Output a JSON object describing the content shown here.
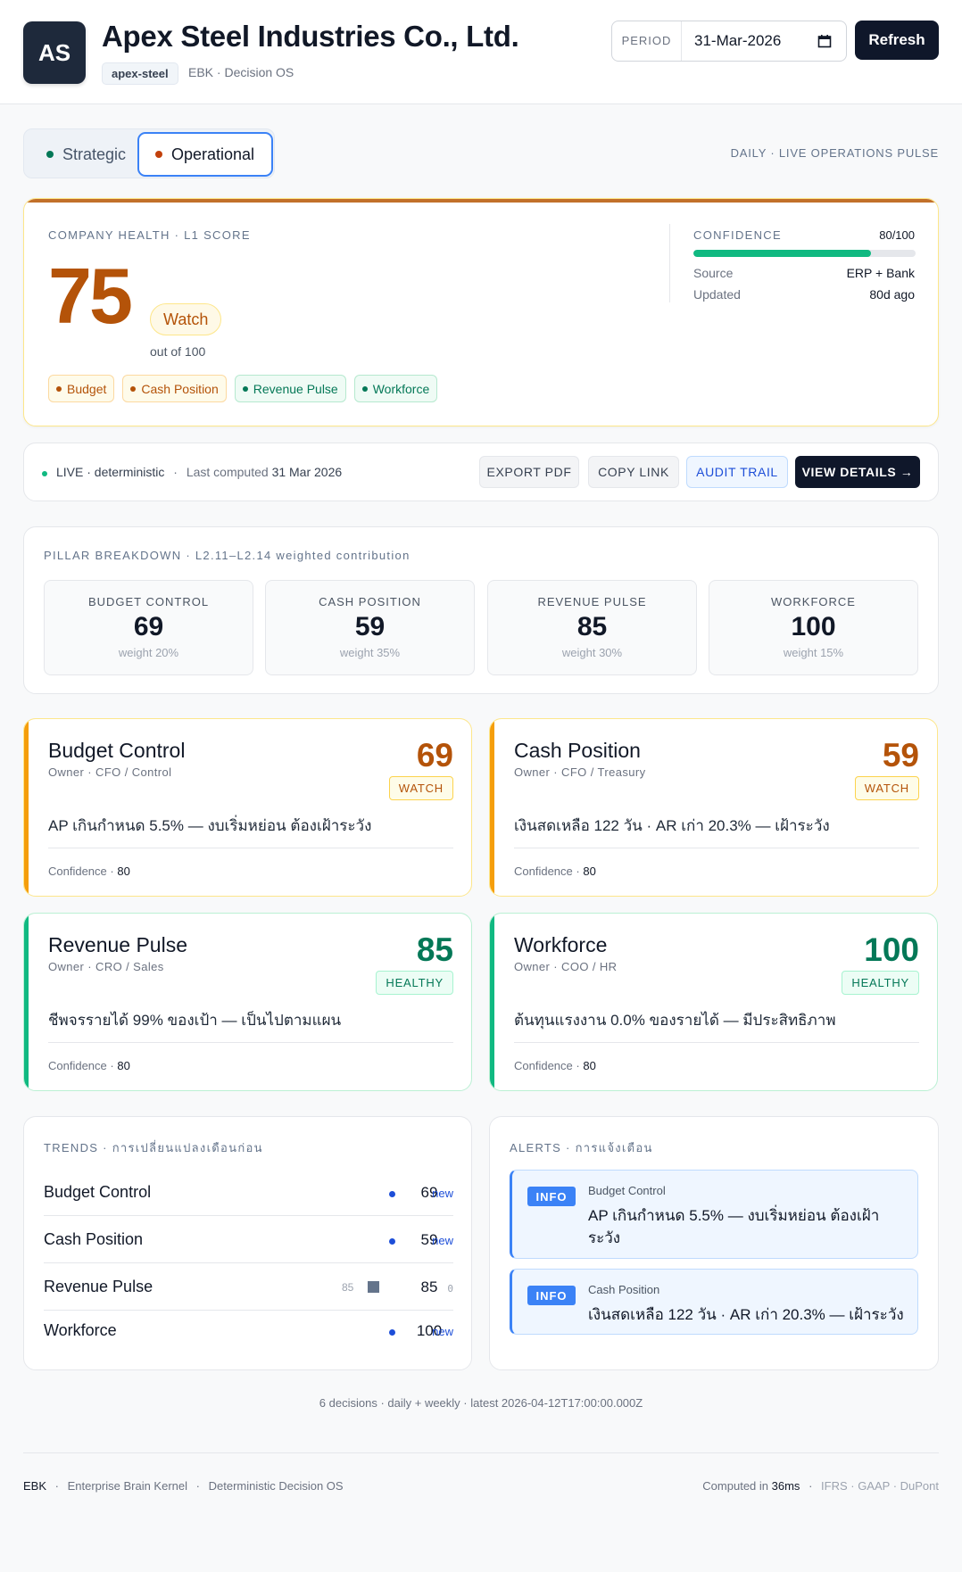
{
  "header": {
    "logo_initials": "AS",
    "company_name": "Apex Steel Industries Co., Ltd.",
    "slug": "apex-steel",
    "subtitle": "EBK · Decision OS",
    "period_label": "PERIOD",
    "period_value": "31-Mar-2026",
    "refresh_label": "Refresh"
  },
  "tabs": [
    {
      "label": "Strategic",
      "active": false,
      "dot_color": "#047857"
    },
    {
      "label": "Operational",
      "active": true,
      "dot_color": "#c2410c"
    }
  ],
  "pulse_label": "DAILY · LIVE OPERATIONS PULSE",
  "health": {
    "section_label": "COMPANY HEALTH · L1 SCORE",
    "score": "75",
    "status": "Watch",
    "out_of": "out of 100",
    "chips": [
      {
        "label": "Budget",
        "tone": "amber"
      },
      {
        "label": "Cash Position",
        "tone": "amber"
      },
      {
        "label": "Revenue Pulse",
        "tone": "green"
      },
      {
        "label": "Workforce",
        "tone": "green"
      }
    ],
    "confidence_label": "CONFIDENCE",
    "confidence_value": "80/100",
    "confidence_fraction": 0.8,
    "source_label": "Source",
    "source_value": "ERP + Bank",
    "updated_label": "Updated",
    "updated_value": "80d ago"
  },
  "action_bar": {
    "live_text": "LIVE · deterministic",
    "separator": "·",
    "last_computed_prefix": "Last computed",
    "last_computed_value": "31 Mar 2026",
    "export_pdf": "EXPORT PDF",
    "copy_link": "COPY LINK",
    "audit_trail": "AUDIT TRAIL",
    "view_details": "VIEW DETAILS →"
  },
  "breakdown": {
    "section_label": "PILLAR BREAKDOWN · L2.11–L2.14 weighted contribution",
    "pillars": [
      {
        "name": "BUDGET CONTROL",
        "score": "69",
        "weight": "weight 20%"
      },
      {
        "name": "CASH POSITION",
        "score": "59",
        "weight": "weight 35%"
      },
      {
        "name": "REVENUE PULSE",
        "score": "85",
        "weight": "weight 30%"
      },
      {
        "name": "WORKFORCE",
        "score": "100",
        "weight": "weight 15%"
      }
    ]
  },
  "pillar_cards": [
    {
      "title": "Budget Control",
      "owner": "Owner · CFO / Control",
      "score": "69",
      "status": "WATCH",
      "tone": "amber",
      "score_color": "#b45309",
      "description": "AP เกินกำหนด 5.5% — งบเริ่มหย่อน ต้องเฝ้าระวัง",
      "confidence_label": "Confidence ·",
      "confidence": "80"
    },
    {
      "title": "Cash Position",
      "owner": "Owner · CFO / Treasury",
      "score": "59",
      "status": "WATCH",
      "tone": "amber",
      "score_color": "#b45309",
      "description": "เงินสดเหลือ 122 วัน · AR เก่า 20.3% — เฝ้าระวัง",
      "confidence_label": "Confidence ·",
      "confidence": "80"
    },
    {
      "title": "Revenue Pulse",
      "owner": "Owner · CRO / Sales",
      "score": "85",
      "status": "HEALTHY",
      "tone": "green",
      "score_color": "#047857",
      "description": "ชีพจรรายได้ 99% ของเป้า — เป็นไปตามแผน",
      "confidence_label": "Confidence ·",
      "confidence": "80"
    },
    {
      "title": "Workforce",
      "owner": "Owner · COO / HR",
      "score": "100",
      "status": "HEALTHY",
      "tone": "green",
      "score_color": "#047857",
      "description": "ต้นทุนแรงงาน 0.0% ของรายได้ — มีประสิทธิภาพ",
      "confidence_label": "Confidence ·",
      "confidence": "80"
    }
  ],
  "trends": {
    "section_label": "TRENDS · การเปลี่ยนแปลงเดือนก่อน",
    "rows": [
      {
        "name": "Budget Control",
        "previous": "",
        "value": "69",
        "delta": "new",
        "marker": "dot"
      },
      {
        "name": "Cash Position",
        "previous": "",
        "value": "59",
        "delta": "new",
        "marker": "dot"
      },
      {
        "name": "Revenue Pulse",
        "previous": "85",
        "value": "85",
        "delta": "0",
        "marker": "square"
      },
      {
        "name": "Workforce",
        "previous": "",
        "value": "100",
        "delta": "new",
        "marker": "dot"
      }
    ]
  },
  "alerts": {
    "section_label": "ALERTS · การแจ้งเตือน",
    "items": [
      {
        "level": "INFO",
        "source": "Budget Control",
        "message": "AP เกินกำหนด 5.5% — งบเริ่มหย่อน ต้องเฝ้าระวัง"
      },
      {
        "level": "INFO",
        "source": "Cash Position",
        "message": "เงินสดเหลือ 122 วัน · AR เก่า 20.3% — เฝ้าระวัง"
      }
    ]
  },
  "decisions_line": "6 decisions · daily + weekly · latest 2026-04-12T17:00:00.000Z",
  "footer": {
    "brand": "EBK",
    "tagline_1": "Enterprise Brain Kernel",
    "tagline_2": "Deterministic Decision OS",
    "computed_prefix": "Computed in",
    "computed_value": "36ms",
    "standards": "IFRS · GAAP · DuPont"
  }
}
